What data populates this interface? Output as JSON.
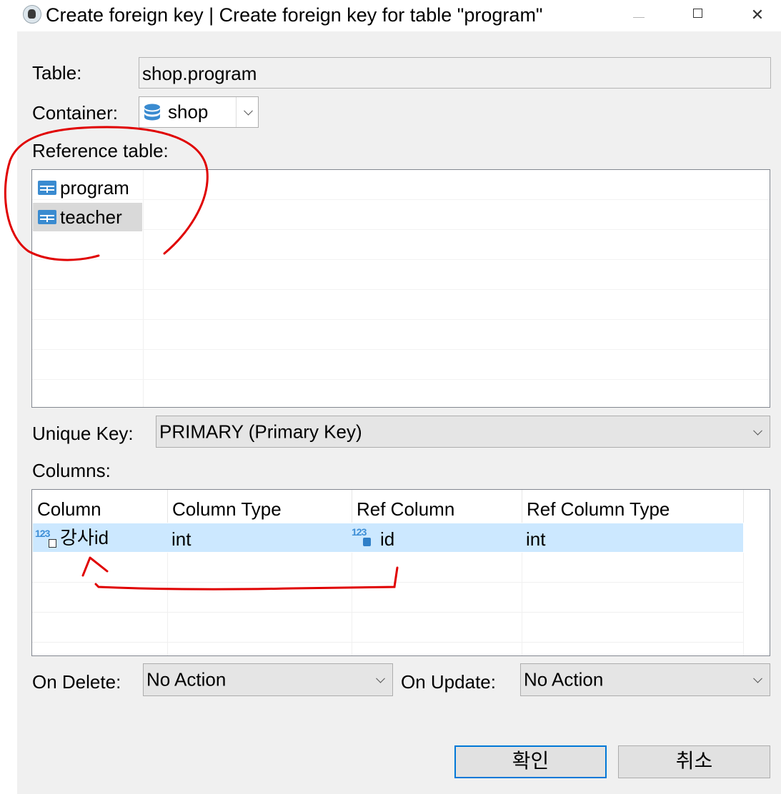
{
  "window": {
    "title": "Create foreign key | Create foreign key for table \"program\"",
    "icons": {
      "app": "dbeaver-beaver-icon",
      "minimize": "minimize-icon",
      "maximize": "maximize-icon",
      "close": "close-icon"
    }
  },
  "form": {
    "table_label": "Table:",
    "table_value": "shop.program",
    "container_label": "Container:",
    "container_value": "shop",
    "container_icon": "database-icon",
    "reference_table_label": "Reference table:",
    "reference_tables": [
      {
        "name": "program",
        "icon": "table-icon",
        "selected": false
      },
      {
        "name": "teacher",
        "icon": "table-icon",
        "selected": true
      }
    ],
    "unique_key_label": "Unique Key:",
    "unique_key_value": "PRIMARY (Primary Key)",
    "columns_label": "Columns:",
    "columns_table": {
      "headers": [
        "Column",
        "Column Type",
        "Ref Column",
        "Ref Column Type"
      ],
      "rows": [
        {
          "column": "강사id",
          "column_icon": "numeric-column-icon",
          "column_type": "int",
          "ref_column": "id",
          "ref_column_icon": "numeric-key-column-icon",
          "ref_column_type": "int",
          "selected": true
        }
      ]
    },
    "on_delete_label": "On Delete:",
    "on_delete_value": "No Action",
    "on_update_label": "On Update:",
    "on_update_value": "No Action"
  },
  "buttons": {
    "ok": "확인",
    "cancel": "취소"
  },
  "colors": {
    "selection": "#cce8ff",
    "accent": "#0078d7",
    "annotation": "#e00000",
    "dialog_bg": "#f0f0f0"
  }
}
